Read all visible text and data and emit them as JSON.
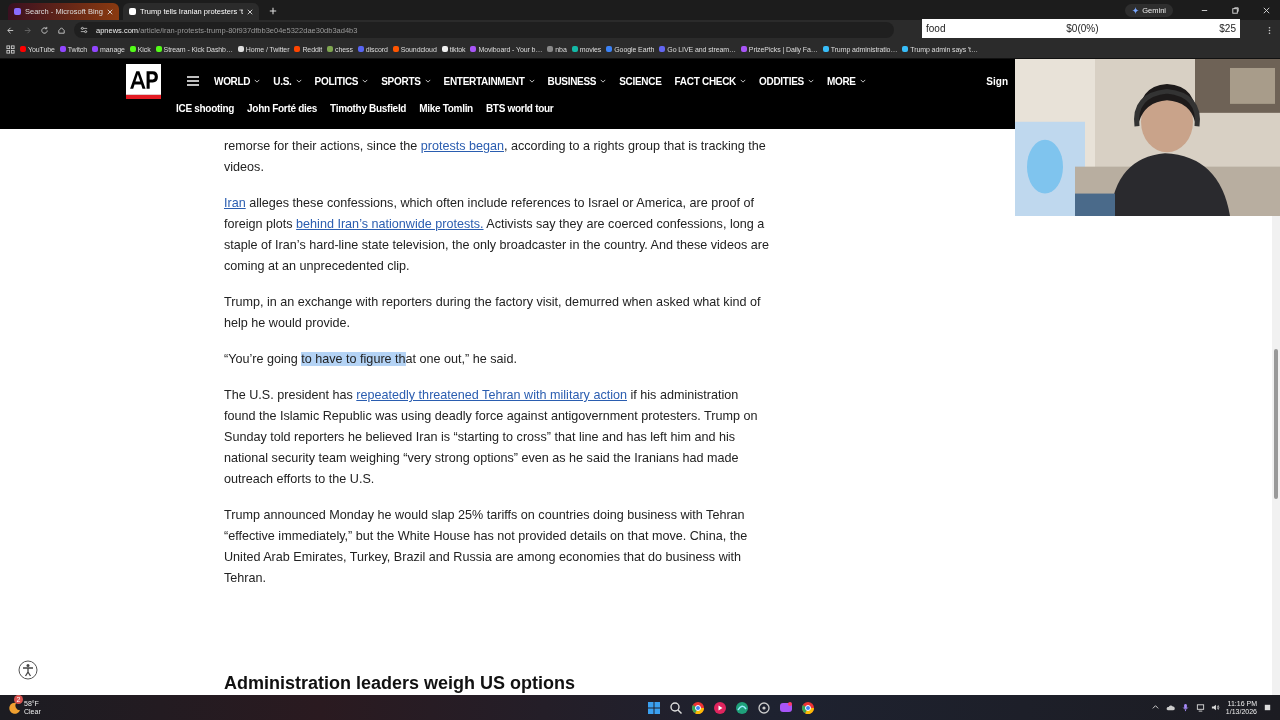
{
  "browser": {
    "tabs": [
      {
        "title": "Search - Microsoft Bing",
        "selected": false
      },
      {
        "title": "Trump tells Iranian protesters ‘t",
        "selected": true
      }
    ],
    "gemini": "Gemini",
    "address": {
      "domain": "apnews.com",
      "path": "/article/iran-protests-trump-80f937dfbb3e04e5322dae30db3ad4b3"
    },
    "bookmarks": [
      "YouTube",
      "Twitch",
      "manage",
      "Kick",
      "Stream - Kick Dashb…",
      "Home / Twitter",
      "Reddit",
      "chess",
      "discord",
      "Soundcloud",
      "tiktok",
      "Moviboard - Your b…",
      "nba",
      "movies",
      "Google Earth",
      "Go LIVE and stream…",
      "PrizePicks | Daily Fa…",
      "Trump administratio…",
      "Trump admin says 't…"
    ]
  },
  "overlay": {
    "goal": {
      "label": "food",
      "progress": "$0(0%)",
      "target": "$25"
    }
  },
  "header": {
    "nav": [
      {
        "label": "WORLD",
        "has_menu": true
      },
      {
        "label": "U.S.",
        "has_menu": true
      },
      {
        "label": "POLITICS",
        "has_menu": true
      },
      {
        "label": "SPORTS",
        "has_menu": true
      },
      {
        "label": "ENTERTAINMENT",
        "has_menu": true
      },
      {
        "label": "BUSINESS",
        "has_menu": true
      },
      {
        "label": "SCIENCE",
        "has_menu": false
      },
      {
        "label": "FACT CHECK",
        "has_menu": true
      },
      {
        "label": "ODDITIES",
        "has_menu": true
      },
      {
        "label": "MORE",
        "has_menu": true
      }
    ],
    "sign_in": "Sign",
    "trending": [
      "ICE shooting",
      "John Forté dies",
      "Timothy Busfield",
      "Mike Tomlin",
      "BTS world tour"
    ]
  },
  "article": {
    "paragraphs": [
      [
        {
          "kind": "text",
          "text": "remorse for their actions, since the "
        },
        {
          "kind": "link",
          "text": "protests began"
        },
        {
          "kind": "text",
          "text": ", according to a rights group that is tracking the videos."
        }
      ],
      [
        {
          "kind": "link",
          "text": "Iran"
        },
        {
          "kind": "text",
          "text": " alleges these confessions, which often include references to Israel or America, are proof of foreign plots "
        },
        {
          "kind": "link",
          "text": "behind Iran’s nationwide protests."
        },
        {
          "kind": "text",
          "text": " Activists say they are coerced confessions, long a staple of Iran’s hard-line state television, the only broadcaster in the country. And these videos are coming at an unprecedented clip."
        }
      ],
      [
        {
          "kind": "text",
          "text": "Trump, in an exchange with reporters during the factory visit, demurred when asked what kind of help he would provide."
        }
      ],
      [
        {
          "kind": "text",
          "text": "“You’re going "
        },
        {
          "kind": "selection",
          "text": "to have to figure th"
        },
        {
          "kind": "text",
          "text": "at one out,” he said."
        }
      ],
      [
        {
          "kind": "text",
          "text": "The U.S. president has "
        },
        {
          "kind": "link",
          "text": "repeatedly threatened Tehran with military action"
        },
        {
          "kind": "text",
          "text": " if his administration found the Islamic Republic was using deadly force against antigovernment protesters. Trump on Sunday told reporters he believed Iran is “starting to cross” that line and has left him and his national security team weighing “very strong options” even as he said the Iranians had made outreach efforts to the U.S."
        }
      ],
      [
        {
          "kind": "text",
          "text": "Trump announced Monday he would slap 25% tariffs on countries doing business with Tehran “effective immediately,” but the White House has not provided details on that move. China, the United Arab Emirates, Turkey, Brazil and Russia are among economies that do business with Tehran."
        }
      ]
    ],
    "heading": "Administration leaders weigh US options"
  },
  "taskbar": {
    "weather": {
      "temp": "58°F",
      "condition": "Clear",
      "badge": "2"
    },
    "time": "11:16 PM",
    "date": "1/13/2026"
  }
}
